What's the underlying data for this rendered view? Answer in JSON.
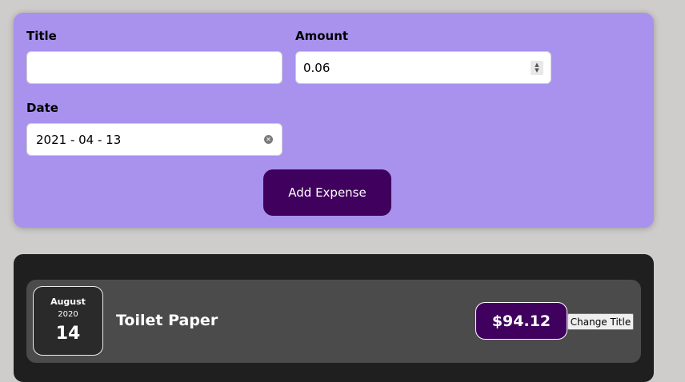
{
  "form": {
    "title_label": "Title",
    "title_value": "",
    "amount_label": "Amount",
    "amount_value": "0.06",
    "date_label": "Date",
    "date_value": "2021 - 04 - 13",
    "submit_label": "Add Expense"
  },
  "expenses": [
    {
      "month": "August",
      "year": "2020",
      "day": "14",
      "title": "Toilet Paper",
      "amount": "$94.12",
      "change_label": "Change Title"
    }
  ],
  "colors": {
    "background": "#cfcdcb",
    "form_bg": "#a892ee",
    "accent": "#40005d",
    "list_bg": "#1f1f1f",
    "item_bg": "#4b4b4b"
  }
}
